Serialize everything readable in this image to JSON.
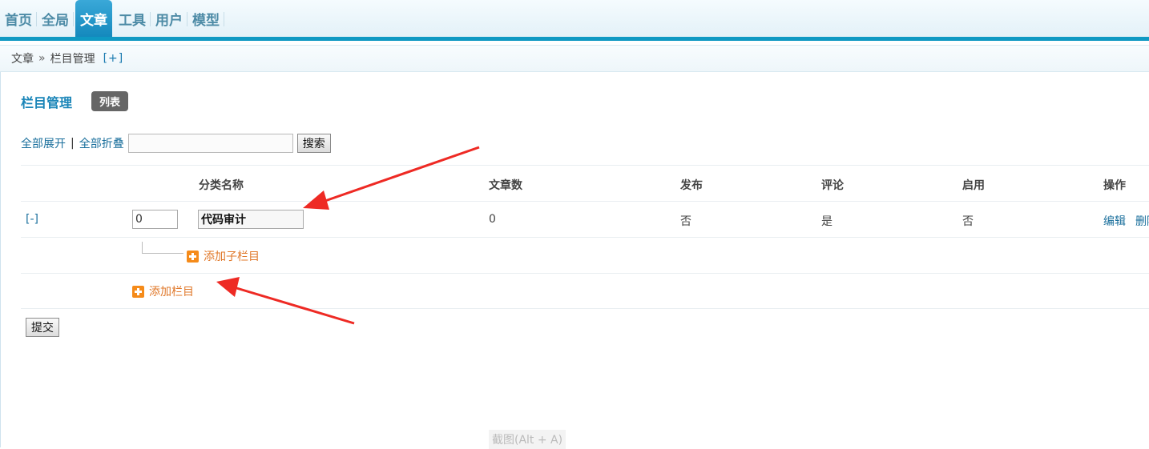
{
  "nav": {
    "items": [
      {
        "label": "首页"
      },
      {
        "label": "全局"
      },
      {
        "label": "文章"
      },
      {
        "label": "工具"
      },
      {
        "label": "用户"
      },
      {
        "label": "模型"
      }
    ],
    "active_index": 2
  },
  "breadcrumb": {
    "section": "文章",
    "separator": "»",
    "page": "栏目管理",
    "add": "[+]"
  },
  "page": {
    "title": "栏目管理",
    "badge": "列表"
  },
  "toolbar": {
    "expand_all": "全部展开",
    "separator": "|",
    "collapse_all": "全部折叠",
    "search_value": "",
    "search_button": "搜索"
  },
  "table": {
    "headers": {
      "name": "分类名称",
      "articles": "文章数",
      "publish": "发布",
      "comment": "评论",
      "enabled": "启用",
      "actions": "操作"
    },
    "rows": [
      {
        "toggle": "[-]",
        "order": "0",
        "name": "代码审计",
        "articles": "0",
        "publish": "否",
        "comment": "是",
        "enabled": "否",
        "edit": "编辑",
        "delete": "删除"
      }
    ],
    "add_child": "添加子栏目",
    "add_category": "添加栏目"
  },
  "form": {
    "submit": "提交"
  },
  "watermark": "截图(Alt + A)",
  "colors": {
    "accent": "#0f99c3",
    "link": "#1a6f9c",
    "add": "#f58b1a",
    "arrow": "#ee2a24"
  }
}
